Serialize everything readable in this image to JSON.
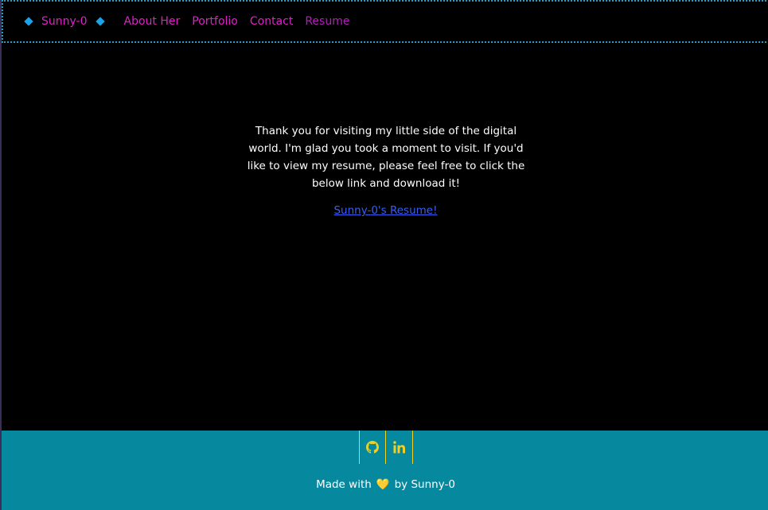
{
  "nav": {
    "brand": "Sunny-0",
    "links": [
      "About Her",
      "Portfolio",
      "Contact",
      "Resume"
    ],
    "active": "Resume",
    "icons": [
      "diamond-icon",
      "diamond-icon"
    ]
  },
  "main": {
    "intro": "Thank you for visiting my little side of the digital world. I'm glad you took a moment to visit. If you'd like to view my resume, please feel free to click the below link and download it!",
    "resume_link": "Sunny-0's Resume!"
  },
  "footer": {
    "social": [
      "github-icon",
      "linkedin-icon"
    ],
    "made_with_prefix": "Made with",
    "heart": "💛",
    "made_with_suffix": "by Sunny-0"
  },
  "colors": {
    "background": "#000000",
    "nav_text": "#e020c8",
    "nav_border": "#1aa3c8",
    "link": "#3a5ff0",
    "footer_bg": "#06899e",
    "footer_accent": "#f0d020"
  }
}
